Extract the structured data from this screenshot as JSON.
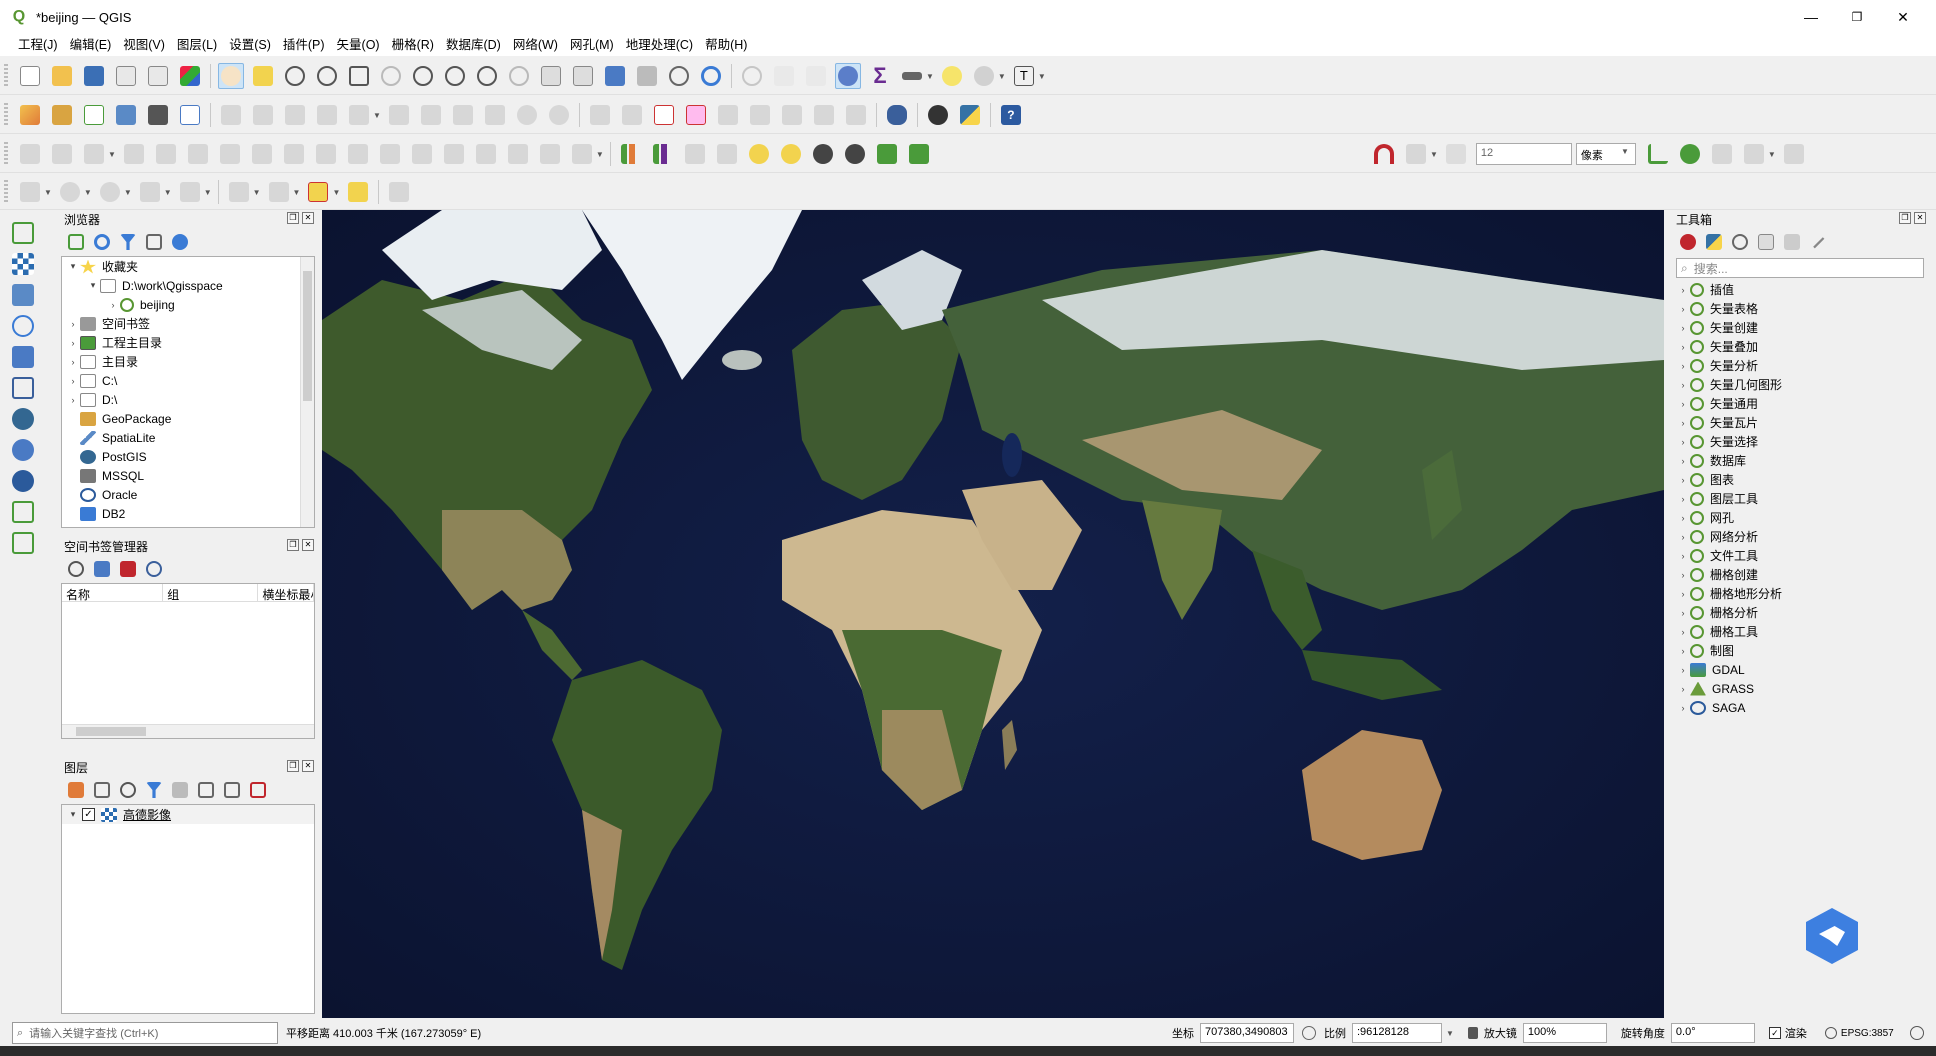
{
  "window": {
    "title": "*beijing — QGIS",
    "controls": [
      "—",
      "❐",
      "✕"
    ]
  },
  "menu": [
    "工程(J)",
    "编辑(E)",
    "视图(V)",
    "图层(L)",
    "设置(S)",
    "插件(P)",
    "矢量(O)",
    "栅格(R)",
    "数据库(D)",
    "网络(W)",
    "网孔(M)",
    "地理处理(C)",
    "帮助(H)"
  ],
  "snapping": {
    "tolerance": "12",
    "unit": "像素"
  },
  "browser": {
    "title": "浏览器",
    "items": [
      {
        "label": "收藏夹",
        "icon": "star-icon"
      },
      {
        "label": "D:\\work\\Qgisspace",
        "icon": "folder-icon"
      },
      {
        "label": "beijing",
        "icon": "qgis-project-icon"
      },
      {
        "label": "空间书签",
        "icon": "bookmark-icon"
      },
      {
        "label": "工程主目录",
        "icon": "project-home-icon"
      },
      {
        "label": "主目录",
        "icon": "home-folder-icon"
      },
      {
        "label": "C:\\",
        "icon": "folder-icon"
      },
      {
        "label": "D:\\",
        "icon": "folder-icon"
      },
      {
        "label": "GeoPackage",
        "icon": "geopackage-icon"
      },
      {
        "label": "SpatiaLite",
        "icon": "spatialite-icon"
      },
      {
        "label": "PostGIS",
        "icon": "postgis-icon"
      },
      {
        "label": "MSSQL",
        "icon": "mssql-icon"
      },
      {
        "label": "Oracle",
        "icon": "oracle-icon"
      },
      {
        "label": "DB2",
        "icon": "db2-icon"
      }
    ]
  },
  "bookmarks": {
    "title": "空间书签管理器",
    "columns": [
      "名称",
      "组",
      "横坐标最小"
    ]
  },
  "layers": {
    "title": "图层",
    "items": [
      {
        "label": "高德影像",
        "checked": true
      }
    ]
  },
  "toolbox": {
    "title": "工具箱",
    "search_placeholder": "搜索...",
    "groups": [
      "插值",
      "矢量表格",
      "矢量创建",
      "矢量叠加",
      "矢量分析",
      "矢量几何图形",
      "矢量通用",
      "矢量瓦片",
      "矢量选择",
      "数据库",
      "图表",
      "图层工具",
      "网孔",
      "网络分析",
      "文件工具",
      "栅格创建",
      "栅格地形分析",
      "栅格分析",
      "栅格工具",
      "制图",
      "GDAL",
      "GRASS",
      "SAGA"
    ]
  },
  "status": {
    "search_placeholder": "请输入关键字查找 (Ctrl+K)",
    "message": "平移距离 410.003 千米 (167.273059° E)",
    "coord_label": "坐标",
    "coord_value": "707380,3490803",
    "scale_label": "比例",
    "scale_value": ":96128128",
    "magnifier_label": "放大镜",
    "magnifier_value": "100%",
    "rotation_label": "旋转角度",
    "rotation_value": "0.0°",
    "render_label": "渲染",
    "crs": "EPSG:3857"
  },
  "colors": {
    "qgis_green": "#589632",
    "ocean": "#0e1738",
    "land_green": "#3e5a2c",
    "desert": "#c9b48f",
    "ice": "#e9eef2"
  }
}
